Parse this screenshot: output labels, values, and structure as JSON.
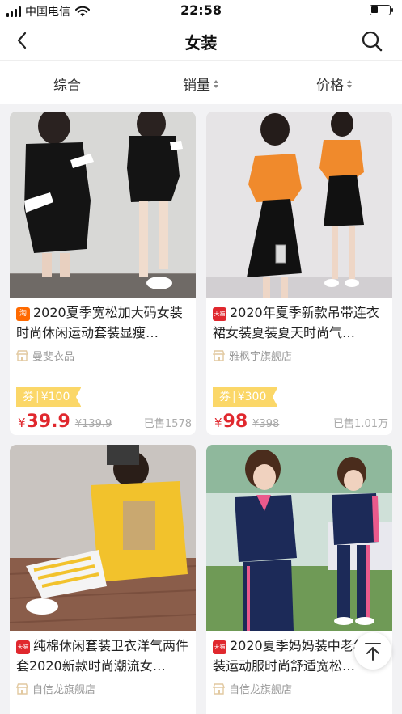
{
  "status_bar": {
    "carrier": "中国电信",
    "time": "22:58"
  },
  "nav": {
    "title": "女装"
  },
  "sort_tabs": [
    {
      "label": "综合"
    },
    {
      "label": "销量"
    },
    {
      "label": "价格"
    }
  ],
  "products": [
    {
      "platform": "淘",
      "title": "2020夏季宽松加大码女装时尚休闲运动套装显瘦…",
      "shop": "曼斐衣品",
      "coupon_prefix": "券",
      "coupon_value": "¥100",
      "currency": "¥",
      "price": "39.9",
      "original_price": "¥139.9",
      "sold": "已售1578"
    },
    {
      "platform": "天猫",
      "title": "2020年夏季新款吊带连衣裙女装夏装夏天时尚气…",
      "shop": "雅枫宇旗舰店",
      "coupon_prefix": "券",
      "coupon_value": "¥300",
      "currency": "¥",
      "price": "98",
      "original_price": "¥398",
      "sold": "已售1.01万"
    },
    {
      "platform": "天猫",
      "title": "纯棉休闲套装卫衣洋气两件套2020新款时尚潮流女…",
      "shop": "自信龙旗舰店"
    },
    {
      "platform": "天猫",
      "title": "2020夏季妈妈装中老年女装运动服时尚舒适宽松…",
      "shop": "自信龙旗舰店"
    }
  ],
  "colors": {
    "price_red": "#e0282e",
    "coupon_yellow": "#fbd768",
    "taobao_orange": "#ff6a00"
  }
}
